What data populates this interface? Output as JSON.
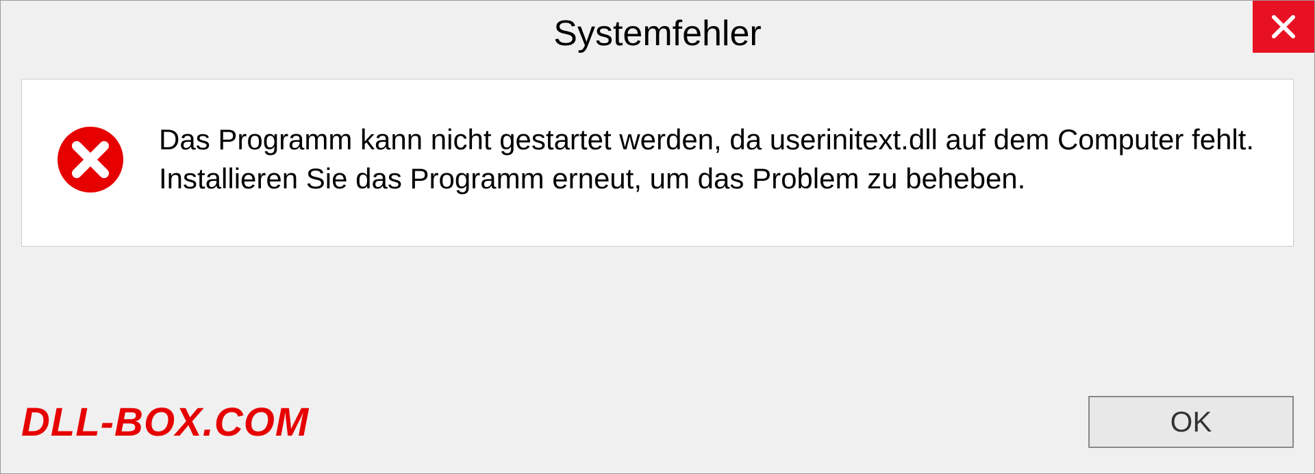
{
  "dialog": {
    "title": "Systemfehler",
    "message": "Das Programm kann nicht gestartet werden, da userinitext.dll auf dem Computer fehlt. Installieren Sie das Programm erneut, um das Problem zu beheben.",
    "ok_label": "OK"
  },
  "watermark": "DLL-BOX.COM"
}
